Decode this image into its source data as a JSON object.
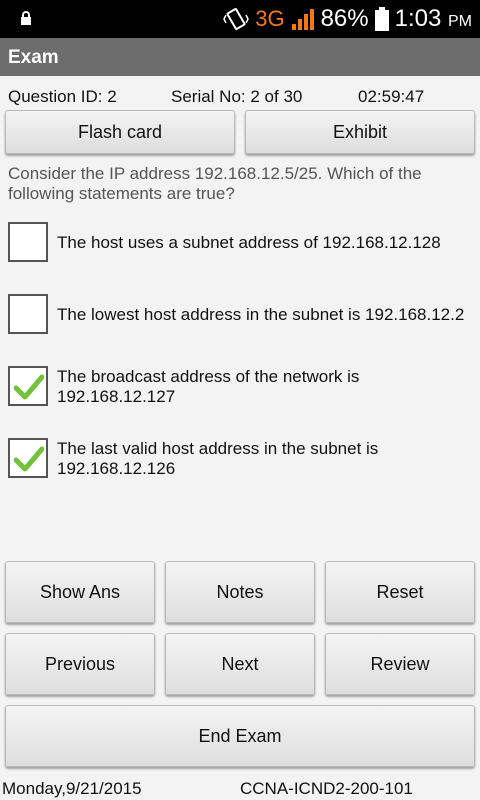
{
  "status_bar": {
    "network": "3G",
    "battery": "86%",
    "time": "1:03",
    "ampm": "PM"
  },
  "header": {
    "title": "Exam"
  },
  "info": {
    "question_id": "Question ID: 2",
    "serial": "Serial No: 2 of 30",
    "timer": "02:59:47"
  },
  "top_buttons": {
    "flash_card": "Flash card",
    "exhibit": "Exhibit"
  },
  "question": "Consider the IP address 192.168.12.5/25. Which of the following statements are true?",
  "options": [
    {
      "text": "The host uses a subnet address of 192.168.12.128",
      "checked": false
    },
    {
      "text": "The lowest host address in the subnet is 192.168.12.2",
      "checked": false
    },
    {
      "text": "The broadcast address of the network is 192.168.12.127",
      "checked": true
    },
    {
      "text": "The last valid host address in the subnet is 192.168.12.126",
      "checked": true
    }
  ],
  "buttons": {
    "show_ans": "Show Ans",
    "notes": "Notes",
    "reset": "Reset",
    "previous": "Previous",
    "next": "Next",
    "review": "Review",
    "end_exam": "End Exam"
  },
  "footer": {
    "date": "Monday,9/21/2015",
    "exam_code": "CCNA-ICND2-200-101"
  }
}
